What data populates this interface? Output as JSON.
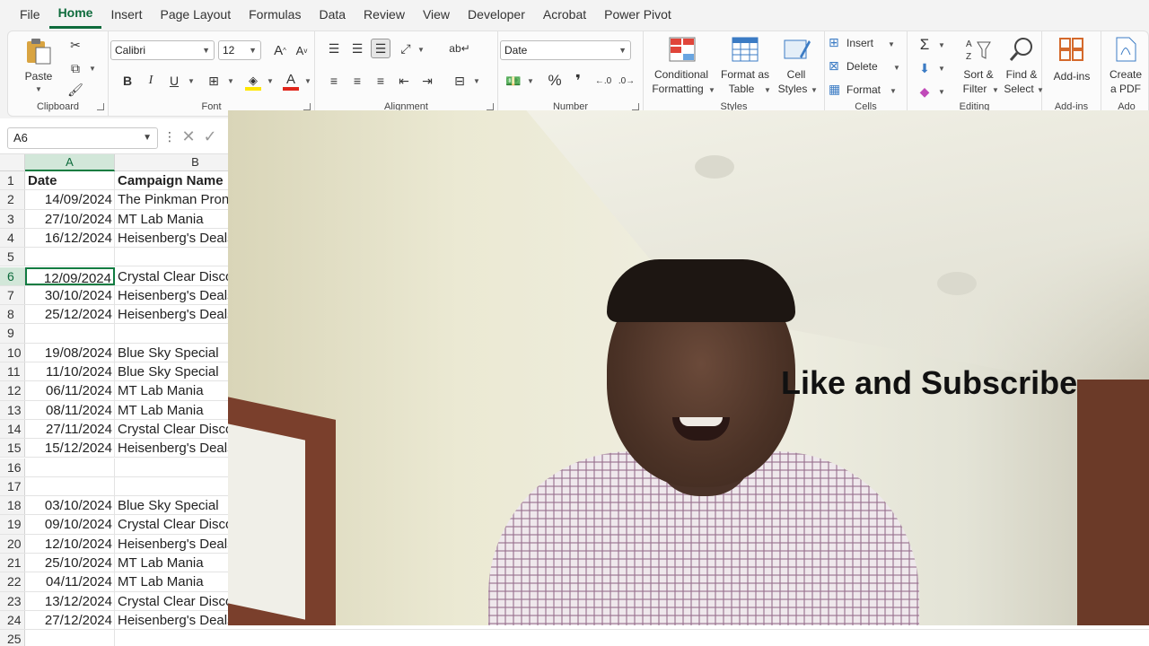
{
  "menu": {
    "items": [
      "File",
      "Home",
      "Insert",
      "Page Layout",
      "Formulas",
      "Data",
      "Review",
      "View",
      "Developer",
      "Acrobat",
      "Power Pivot"
    ],
    "active": "Home"
  },
  "ribbon": {
    "clipboard": {
      "paste": "Paste",
      "label": "Clipboard"
    },
    "font": {
      "name": "Calibri",
      "size": "12",
      "label": "Font",
      "fill_color": "#ffe600",
      "font_color": "#e0261c"
    },
    "alignment": {
      "label": "Alignment"
    },
    "number": {
      "format": "Date",
      "label": "Number"
    },
    "styles": {
      "conditional_1": "Conditional",
      "conditional_2": "Formatting",
      "table_1": "Format as",
      "table_2": "Table",
      "cell_1": "Cell",
      "cell_2": "Styles",
      "label": "Styles"
    },
    "cells": {
      "insert": "Insert",
      "delete": "Delete",
      "format": "Format",
      "label": "Cells"
    },
    "editing": {
      "sort_1": "Sort &",
      "sort_2": "Filter",
      "find_1": "Find &",
      "find_2": "Select",
      "label": "Editing"
    },
    "addins": {
      "addins": "Add-ins",
      "label": "Add-ins"
    },
    "acrobat": {
      "create_1": "Create",
      "create_2": "a PDF",
      "label": "Ado"
    }
  },
  "formula_bar": {
    "name_box": "A6"
  },
  "grid": {
    "columns": [
      "A",
      "B"
    ],
    "selected_column": "A",
    "active_row": "6",
    "rows": [
      {
        "num": "1",
        "a": "Date",
        "b": "Campaign Name",
        "header": true
      },
      {
        "num": "2",
        "a": "14/09/2024",
        "b": "The Pinkman Pron"
      },
      {
        "num": "3",
        "a": "27/10/2024",
        "b": "MT Lab Mania"
      },
      {
        "num": "4",
        "a": "16/12/2024",
        "b": "Heisenberg's Deals"
      },
      {
        "num": "5",
        "a": "",
        "b": ""
      },
      {
        "num": "6",
        "a": "12/09/2024",
        "b": "Crystal Clear Disco"
      },
      {
        "num": "7",
        "a": "30/10/2024",
        "b": "Heisenberg's Deals"
      },
      {
        "num": "8",
        "a": "25/12/2024",
        "b": "Heisenberg's Deals"
      },
      {
        "num": "9",
        "a": "",
        "b": ""
      },
      {
        "num": "10",
        "a": "19/08/2024",
        "b": "Blue Sky Special"
      },
      {
        "num": "11",
        "a": "11/10/2024",
        "b": "Blue Sky Special"
      },
      {
        "num": "12",
        "a": "06/11/2024",
        "b": "MT Lab Mania"
      },
      {
        "num": "13",
        "a": "08/11/2024",
        "b": "MT Lab Mania"
      },
      {
        "num": "14",
        "a": "27/11/2024",
        "b": "Crystal Clear Disco"
      },
      {
        "num": "15",
        "a": "15/12/2024",
        "b": "Heisenberg's Deals"
      },
      {
        "num": "16",
        "a": "",
        "b": ""
      },
      {
        "num": "17",
        "a": "",
        "b": ""
      },
      {
        "num": "18",
        "a": "03/10/2024",
        "b": "Blue Sky Special"
      },
      {
        "num": "19",
        "a": "09/10/2024",
        "b": "Crystal Clear Disco"
      },
      {
        "num": "20",
        "a": "12/10/2024",
        "b": "Heisenberg's Deals"
      },
      {
        "num": "21",
        "a": "25/10/2024",
        "b": "MT Lab Mania"
      },
      {
        "num": "22",
        "a": "04/11/2024",
        "b": "MT Lab Mania"
      },
      {
        "num": "23",
        "a": "13/12/2024",
        "b": "Crystal Clear Disco"
      },
      {
        "num": "24",
        "a": "27/12/2024",
        "b": "Heisenberg's Deals"
      },
      {
        "num": "25",
        "a": "",
        "b": ""
      }
    ]
  },
  "overlay": {
    "text": "Like and Subscribe"
  }
}
